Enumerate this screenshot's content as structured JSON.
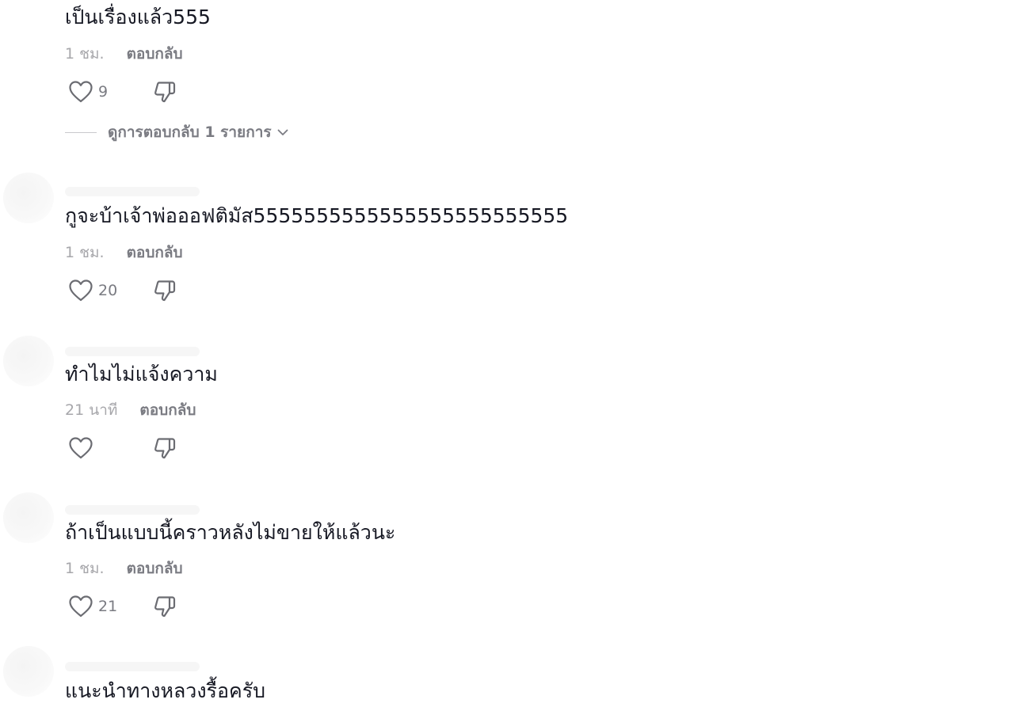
{
  "comments": [
    {
      "text": "เป็นเรื่องแล้ว555",
      "timestamp": "1 ชม.",
      "reply_label": "ตอบกลับ",
      "likes": "9",
      "view_replies": "ดูการตอบกลับ 1 รายการ"
    },
    {
      "text": "กูจะบ้าเจ้าพ่อออฟติมัส5555555555555555555555555",
      "timestamp": "1 ชม.",
      "reply_label": "ตอบกลับ",
      "likes": "20"
    },
    {
      "text": "ทำไมไม่แจ้งความ",
      "timestamp": "21 นาที",
      "reply_label": "ตอบกลับ",
      "likes": ""
    },
    {
      "text": "ถ้าเป็นแบบนี้คราวหลังไม่ขายให้แล้วนะ",
      "timestamp": "1 ชม.",
      "reply_label": "ตอบกลับ",
      "likes": "21"
    },
    {
      "text": "แนะนำทางหลวงรื้อครับ"
    }
  ],
  "icons": {
    "like": "heart-outline-icon",
    "dislike": "thumbs-down-outline-icon",
    "expand": "chevron-down-icon"
  },
  "colors": {
    "text": "#161823",
    "meta": "#a7a7ab",
    "action": "#7a7b82"
  }
}
